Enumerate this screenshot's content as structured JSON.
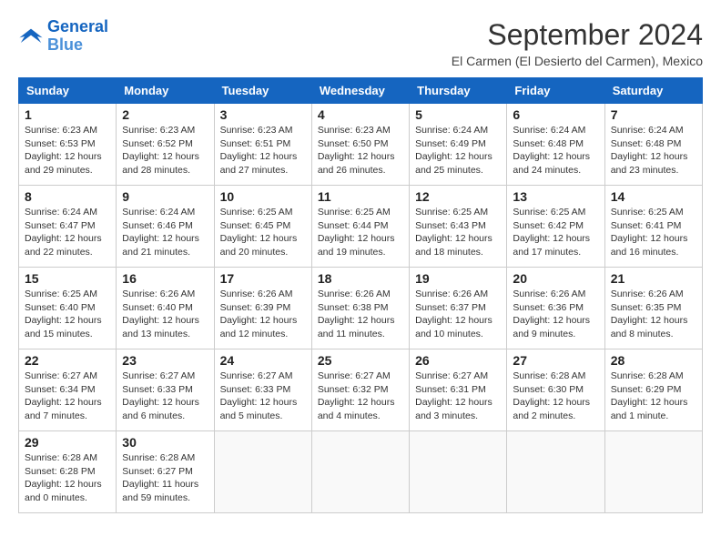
{
  "logo": {
    "line1": "General",
    "line2": "Blue"
  },
  "title": "September 2024",
  "subtitle": "El Carmen (El Desierto del Carmen), Mexico",
  "headers": [
    "Sunday",
    "Monday",
    "Tuesday",
    "Wednesday",
    "Thursday",
    "Friday",
    "Saturday"
  ],
  "weeks": [
    [
      {
        "day": "1",
        "sunrise": "6:23 AM",
        "sunset": "6:53 PM",
        "daylight": "12 hours and 29 minutes."
      },
      {
        "day": "2",
        "sunrise": "6:23 AM",
        "sunset": "6:52 PM",
        "daylight": "12 hours and 28 minutes."
      },
      {
        "day": "3",
        "sunrise": "6:23 AM",
        "sunset": "6:51 PM",
        "daylight": "12 hours and 27 minutes."
      },
      {
        "day": "4",
        "sunrise": "6:23 AM",
        "sunset": "6:50 PM",
        "daylight": "12 hours and 26 minutes."
      },
      {
        "day": "5",
        "sunrise": "6:24 AM",
        "sunset": "6:49 PM",
        "daylight": "12 hours and 25 minutes."
      },
      {
        "day": "6",
        "sunrise": "6:24 AM",
        "sunset": "6:48 PM",
        "daylight": "12 hours and 24 minutes."
      },
      {
        "day": "7",
        "sunrise": "6:24 AM",
        "sunset": "6:48 PM",
        "daylight": "12 hours and 23 minutes."
      }
    ],
    [
      {
        "day": "8",
        "sunrise": "6:24 AM",
        "sunset": "6:47 PM",
        "daylight": "12 hours and 22 minutes."
      },
      {
        "day": "9",
        "sunrise": "6:24 AM",
        "sunset": "6:46 PM",
        "daylight": "12 hours and 21 minutes."
      },
      {
        "day": "10",
        "sunrise": "6:25 AM",
        "sunset": "6:45 PM",
        "daylight": "12 hours and 20 minutes."
      },
      {
        "day": "11",
        "sunrise": "6:25 AM",
        "sunset": "6:44 PM",
        "daylight": "12 hours and 19 minutes."
      },
      {
        "day": "12",
        "sunrise": "6:25 AM",
        "sunset": "6:43 PM",
        "daylight": "12 hours and 18 minutes."
      },
      {
        "day": "13",
        "sunrise": "6:25 AM",
        "sunset": "6:42 PM",
        "daylight": "12 hours and 17 minutes."
      },
      {
        "day": "14",
        "sunrise": "6:25 AM",
        "sunset": "6:41 PM",
        "daylight": "12 hours and 16 minutes."
      }
    ],
    [
      {
        "day": "15",
        "sunrise": "6:25 AM",
        "sunset": "6:40 PM",
        "daylight": "12 hours and 15 minutes."
      },
      {
        "day": "16",
        "sunrise": "6:26 AM",
        "sunset": "6:40 PM",
        "daylight": "12 hours and 13 minutes."
      },
      {
        "day": "17",
        "sunrise": "6:26 AM",
        "sunset": "6:39 PM",
        "daylight": "12 hours and 12 minutes."
      },
      {
        "day": "18",
        "sunrise": "6:26 AM",
        "sunset": "6:38 PM",
        "daylight": "12 hours and 11 minutes."
      },
      {
        "day": "19",
        "sunrise": "6:26 AM",
        "sunset": "6:37 PM",
        "daylight": "12 hours and 10 minutes."
      },
      {
        "day": "20",
        "sunrise": "6:26 AM",
        "sunset": "6:36 PM",
        "daylight": "12 hours and 9 minutes."
      },
      {
        "day": "21",
        "sunrise": "6:26 AM",
        "sunset": "6:35 PM",
        "daylight": "12 hours and 8 minutes."
      }
    ],
    [
      {
        "day": "22",
        "sunrise": "6:27 AM",
        "sunset": "6:34 PM",
        "daylight": "12 hours and 7 minutes."
      },
      {
        "day": "23",
        "sunrise": "6:27 AM",
        "sunset": "6:33 PM",
        "daylight": "12 hours and 6 minutes."
      },
      {
        "day": "24",
        "sunrise": "6:27 AM",
        "sunset": "6:33 PM",
        "daylight": "12 hours and 5 minutes."
      },
      {
        "day": "25",
        "sunrise": "6:27 AM",
        "sunset": "6:32 PM",
        "daylight": "12 hours and 4 minutes."
      },
      {
        "day": "26",
        "sunrise": "6:27 AM",
        "sunset": "6:31 PM",
        "daylight": "12 hours and 3 minutes."
      },
      {
        "day": "27",
        "sunrise": "6:28 AM",
        "sunset": "6:30 PM",
        "daylight": "12 hours and 2 minutes."
      },
      {
        "day": "28",
        "sunrise": "6:28 AM",
        "sunset": "6:29 PM",
        "daylight": "12 hours and 1 minute."
      }
    ],
    [
      {
        "day": "29",
        "sunrise": "6:28 AM",
        "sunset": "6:28 PM",
        "daylight": "12 hours and 0 minutes."
      },
      {
        "day": "30",
        "sunrise": "6:28 AM",
        "sunset": "6:27 PM",
        "daylight": "11 hours and 59 minutes."
      },
      null,
      null,
      null,
      null,
      null
    ]
  ],
  "labels": {
    "sunrise": "Sunrise: ",
    "sunset": "Sunset: ",
    "daylight": "Daylight hours"
  }
}
